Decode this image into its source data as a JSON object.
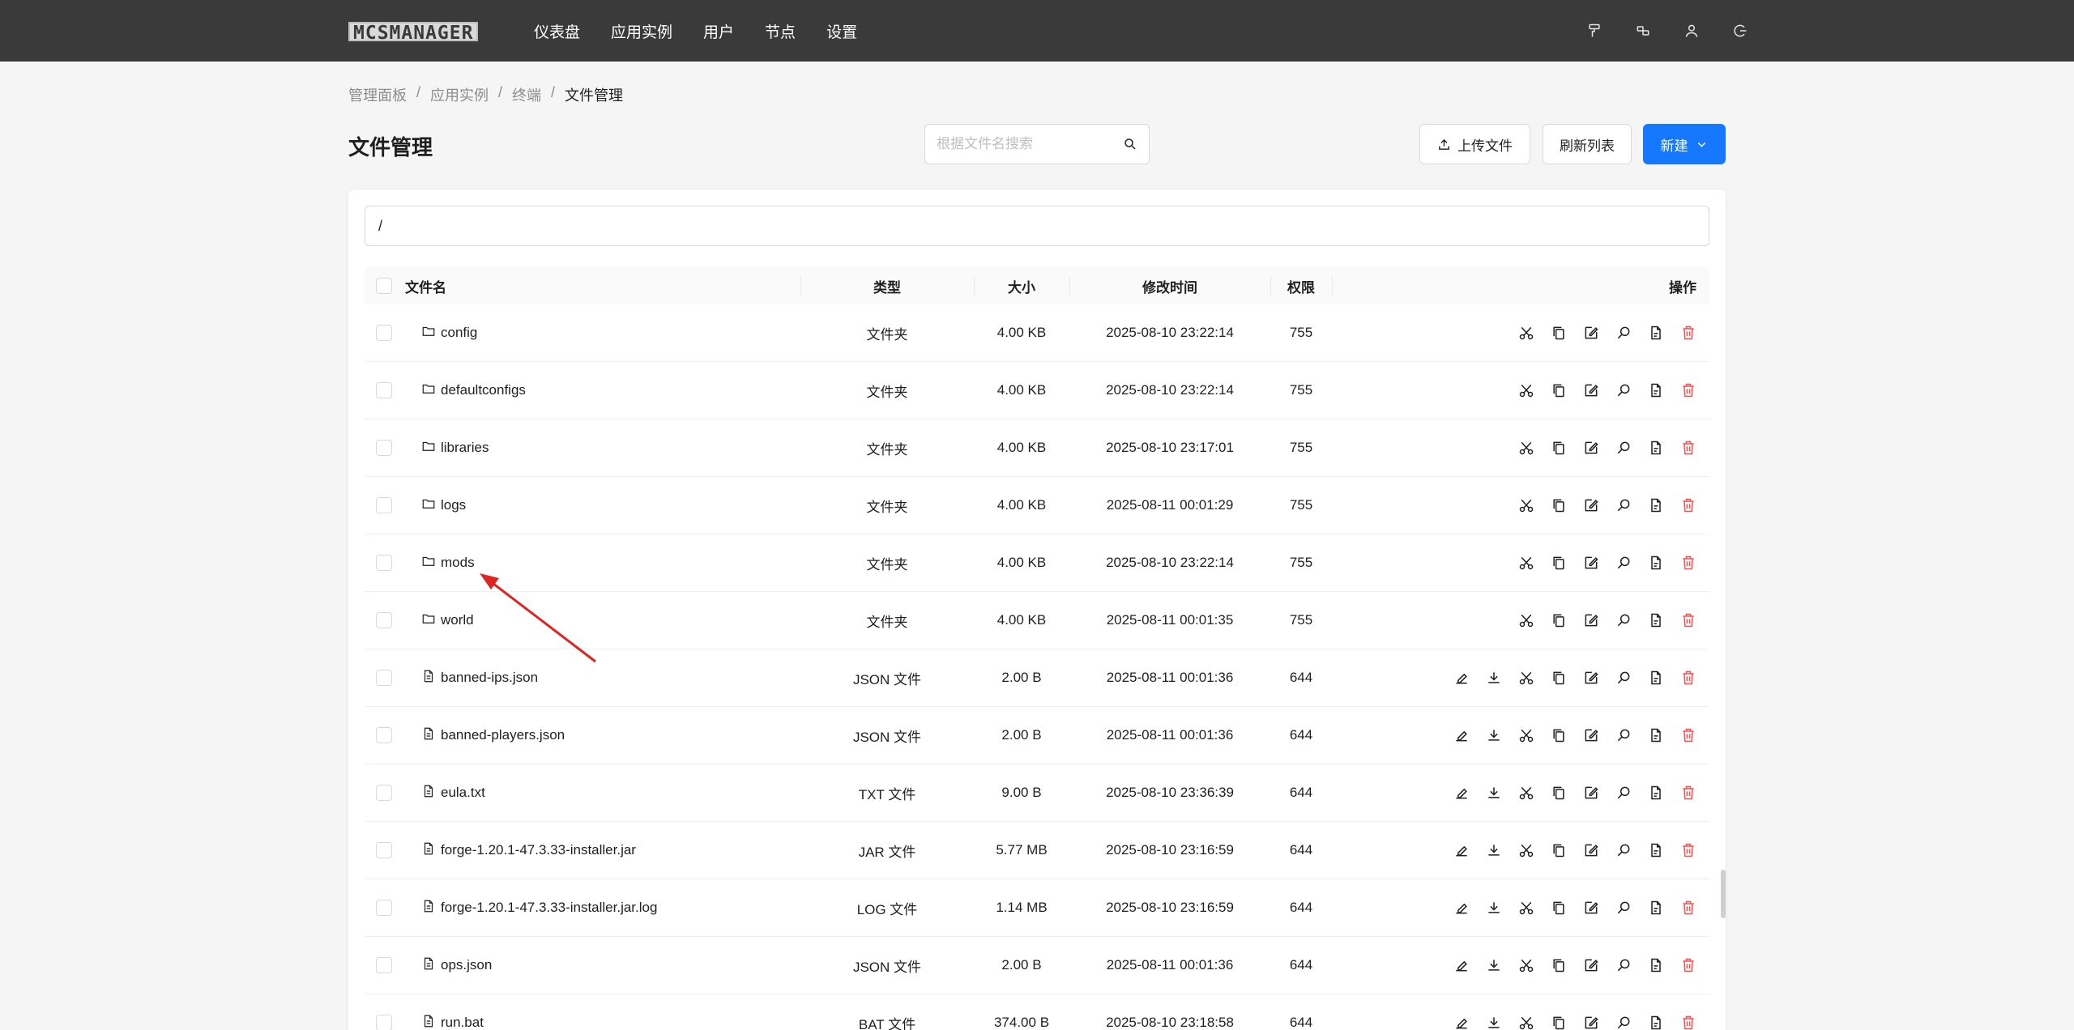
{
  "app": {
    "logo_text": "MCSMANAGER"
  },
  "nav": {
    "items": [
      {
        "label": "仪表盘"
      },
      {
        "label": "应用实例"
      },
      {
        "label": "用户"
      },
      {
        "label": "节点"
      },
      {
        "label": "设置"
      }
    ]
  },
  "breadcrumb": [
    "管理面板",
    "应用实例",
    "终端",
    "文件管理"
  ],
  "page": {
    "title": "文件管理"
  },
  "search": {
    "placeholder": "根据文件名搜索",
    "value": ""
  },
  "toolbar": {
    "upload_label": "上传文件",
    "refresh_label": "刷新列表",
    "new_label": "新建"
  },
  "path": {
    "value": "/"
  },
  "table": {
    "headers": {
      "name": "文件名",
      "type": "类型",
      "size": "大小",
      "time": "修改时间",
      "perm": "权限",
      "ops": "操作"
    },
    "rows": [
      {
        "name": "config",
        "type": "文件夹",
        "size": "4.00 KB",
        "time": "2025-08-10 23:22:14",
        "perm": "755",
        "kind": "folder"
      },
      {
        "name": "defaultconfigs",
        "type": "文件夹",
        "size": "4.00 KB",
        "time": "2025-08-10 23:22:14",
        "perm": "755",
        "kind": "folder"
      },
      {
        "name": "libraries",
        "type": "文件夹",
        "size": "4.00 KB",
        "time": "2025-08-10 23:17:01",
        "perm": "755",
        "kind": "folder"
      },
      {
        "name": "logs",
        "type": "文件夹",
        "size": "4.00 KB",
        "time": "2025-08-11 00:01:29",
        "perm": "755",
        "kind": "folder"
      },
      {
        "name": "mods",
        "type": "文件夹",
        "size": "4.00 KB",
        "time": "2025-08-10 23:22:14",
        "perm": "755",
        "kind": "folder"
      },
      {
        "name": "world",
        "type": "文件夹",
        "size": "4.00 KB",
        "time": "2025-08-11 00:01:35",
        "perm": "755",
        "kind": "folder"
      },
      {
        "name": "banned-ips.json",
        "type": "JSON 文件",
        "size": "2.00 B",
        "time": "2025-08-11 00:01:36",
        "perm": "644",
        "kind": "file"
      },
      {
        "name": "banned-players.json",
        "type": "JSON 文件",
        "size": "2.00 B",
        "time": "2025-08-11 00:01:36",
        "perm": "644",
        "kind": "file"
      },
      {
        "name": "eula.txt",
        "type": "TXT 文件",
        "size": "9.00 B",
        "time": "2025-08-10 23:36:39",
        "perm": "644",
        "kind": "file"
      },
      {
        "name": "forge-1.20.1-47.3.33-installer.jar",
        "type": "JAR 文件",
        "size": "5.77 MB",
        "time": "2025-08-10 23:16:59",
        "perm": "644",
        "kind": "file"
      },
      {
        "name": "forge-1.20.1-47.3.33-installer.jar.log",
        "type": "LOG 文件",
        "size": "1.14 MB",
        "time": "2025-08-10 23:16:59",
        "perm": "644",
        "kind": "file"
      },
      {
        "name": "ops.json",
        "type": "JSON 文件",
        "size": "2.00 B",
        "time": "2025-08-11 00:01:36",
        "perm": "644",
        "kind": "file"
      },
      {
        "name": "run.bat",
        "type": "BAT 文件",
        "size": "374.00 B",
        "time": "2025-08-10 23:18:58",
        "perm": "644",
        "kind": "file"
      }
    ]
  },
  "colors": {
    "topbar": "#3a3a3a",
    "primary": "#1677ff",
    "danger": "#ff4d4f",
    "annotation_arrow": "#e02424"
  }
}
